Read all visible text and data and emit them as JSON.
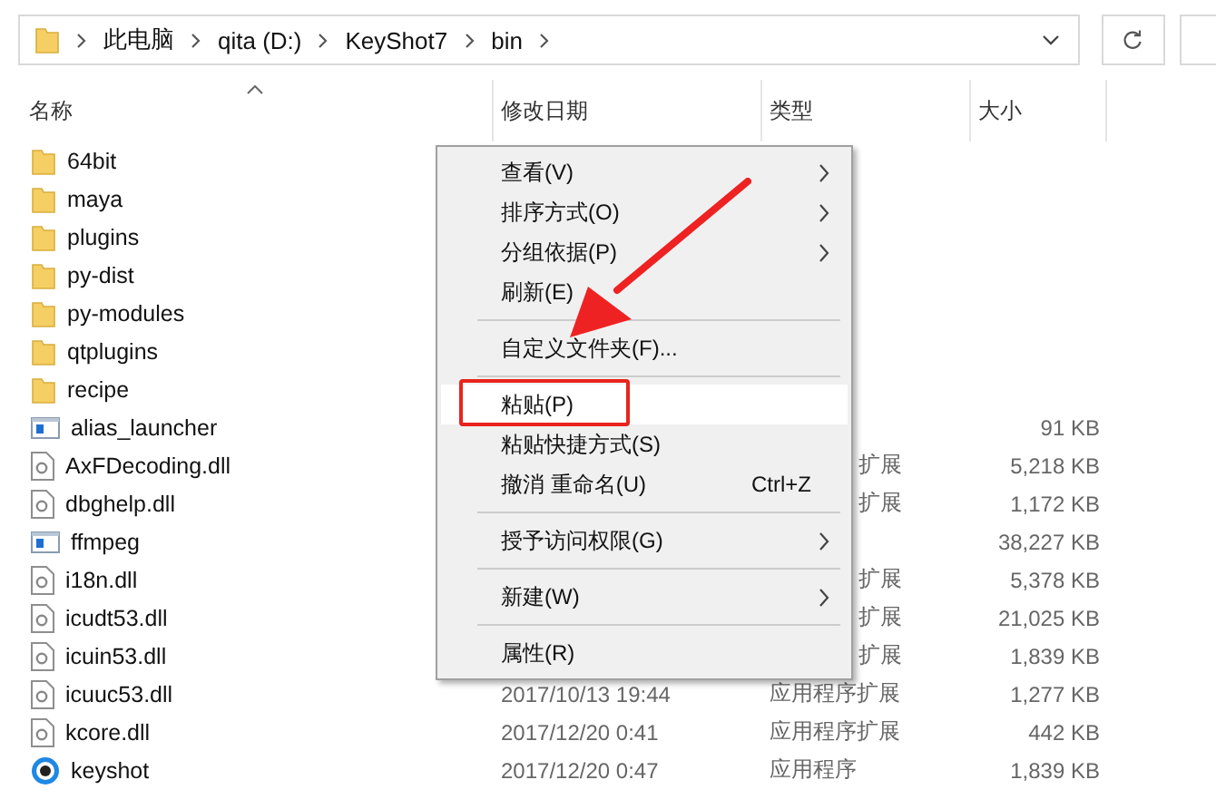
{
  "address": {
    "crumbs": [
      "此电脑",
      "qita (D:)",
      "KeyShot7",
      "bin"
    ]
  },
  "columns": [
    {
      "label": "名称",
      "sorted": true
    },
    {
      "label": "修改日期",
      "sorted": false
    },
    {
      "label": "类型",
      "sorted": false
    },
    {
      "label": "大小",
      "sorted": false
    }
  ],
  "files": [
    {
      "name": "64bit",
      "kind": "folder"
    },
    {
      "name": "maya",
      "kind": "folder"
    },
    {
      "name": "plugins",
      "kind": "folder"
    },
    {
      "name": "py-dist",
      "kind": "folder"
    },
    {
      "name": "py-modules",
      "kind": "folder"
    },
    {
      "name": "qtplugins",
      "kind": "folder"
    },
    {
      "name": "recipe",
      "kind": "folder"
    },
    {
      "name": "alias_launcher",
      "kind": "app",
      "size": "91 KB"
    },
    {
      "name": "AxFDecoding.dll",
      "kind": "dll",
      "type": "扩展",
      "size": "5,218 KB"
    },
    {
      "name": "dbghelp.dll",
      "kind": "dll",
      "type": "扩展",
      "size": "1,172 KB"
    },
    {
      "name": "ffmpeg",
      "kind": "app",
      "size": "38,227 KB"
    },
    {
      "name": "i18n.dll",
      "kind": "dll",
      "type": "扩展",
      "size": "5,378 KB"
    },
    {
      "name": "icudt53.dll",
      "kind": "dll",
      "type": "扩展",
      "size": "21,025 KB"
    },
    {
      "name": "icuin53.dll",
      "kind": "dll",
      "type": "扩展",
      "size": "1,839 KB"
    },
    {
      "name": "icuuc53.dll",
      "kind": "dll",
      "date": "2017/10/13 19:44",
      "type": "应用程序扩展",
      "size": "1,277 KB"
    },
    {
      "name": "kcore.dll",
      "kind": "dll",
      "date": "2017/12/20 0:41",
      "type": "应用程序扩展",
      "size": "442 KB"
    },
    {
      "name": "keyshot",
      "kind": "keyshot",
      "date": "2017/12/20 0:47",
      "type": "应用程序",
      "size": "1,839 KB"
    }
  ],
  "menu": [
    {
      "kind": "item",
      "label": "查看(V)",
      "submenu": true,
      "selected": false
    },
    {
      "kind": "item",
      "label": "排序方式(O)",
      "submenu": true,
      "selected": false
    },
    {
      "kind": "item",
      "label": "分组依据(P)",
      "submenu": true,
      "selected": false
    },
    {
      "kind": "item",
      "label": "刷新(E)",
      "submenu": false,
      "selected": false
    },
    {
      "kind": "separator"
    },
    {
      "kind": "item",
      "label": "自定义文件夹(F)...",
      "submenu": false,
      "selected": false
    },
    {
      "kind": "separator"
    },
    {
      "kind": "item",
      "label": "粘贴(P)",
      "submenu": false,
      "selected": true
    },
    {
      "kind": "item",
      "label": "粘贴快捷方式(S)",
      "submenu": false,
      "selected": false
    },
    {
      "kind": "item",
      "label": "撤消 重命名(U)",
      "shortcut": "Ctrl+Z",
      "submenu": false,
      "selected": false
    },
    {
      "kind": "separator"
    },
    {
      "kind": "item",
      "label": "授予访问权限(G)",
      "submenu": true,
      "selected": false
    },
    {
      "kind": "separator"
    },
    {
      "kind": "item",
      "label": "新建(W)",
      "submenu": true,
      "selected": false
    },
    {
      "kind": "separator"
    },
    {
      "kind": "item",
      "label": "属性(R)",
      "submenu": false,
      "selected": false
    }
  ]
}
